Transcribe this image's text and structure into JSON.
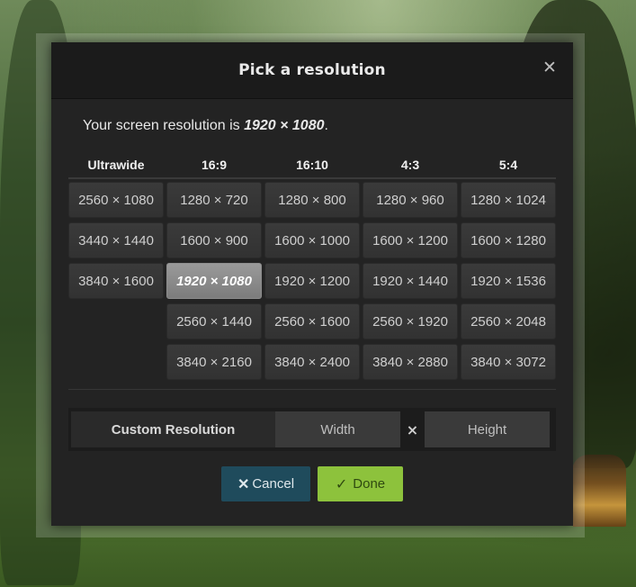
{
  "dialog": {
    "title": "Pick a resolution",
    "close_icon": "close-icon",
    "screen_text_prefix": "Your screen resolution is ",
    "screen_value": "1920 × 1080",
    "screen_text_suffix": "."
  },
  "columns": [
    {
      "header": "Ultrawide",
      "items": [
        "2560 × 1080",
        "3440 × 1440",
        "3840 × 1600"
      ]
    },
    {
      "header": "16:9",
      "items": [
        "1280 × 720",
        "1600 × 900",
        "1920 × 1080",
        "2560 × 1440",
        "3840 × 2160"
      ]
    },
    {
      "header": "16:10",
      "items": [
        "1280 × 800",
        "1600 × 1000",
        "1920 × 1200",
        "2560 × 1600",
        "3840 × 2400"
      ]
    },
    {
      "header": "4:3",
      "items": [
        "1280 × 960",
        "1600 × 1200",
        "1920 × 1440",
        "2560 × 1920",
        "3840 × 2880"
      ]
    },
    {
      "header": "5:4",
      "items": [
        "1280 × 1024",
        "1600 × 1280",
        "1920 × 1536",
        "2560 × 2048",
        "3840 × 3072"
      ]
    }
  ],
  "selected": "1920 × 1080",
  "custom": {
    "label": "Custom Resolution",
    "width_placeholder": "Width",
    "separator": "×",
    "height_placeholder": "Height"
  },
  "actions": {
    "cancel_label": "Cancel",
    "cancel_icon": "x-icon",
    "done_label": "Done",
    "done_icon": "check-icon"
  },
  "colors": {
    "cancel_bg": "#1f4b5c",
    "done_bg": "#8dc23c",
    "selected_bg": "#8a8a8a"
  }
}
